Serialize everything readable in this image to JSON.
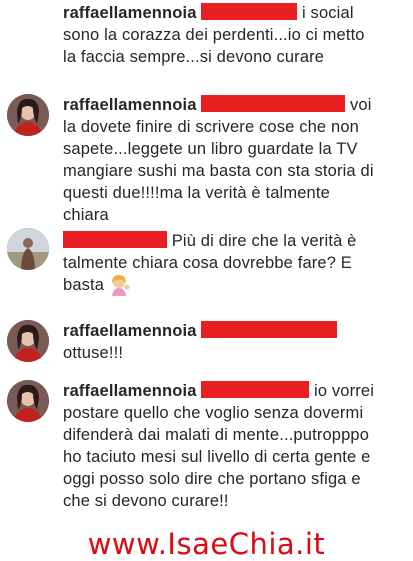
{
  "comments": [
    {
      "avatar": "avatar-photo",
      "username": "raffaellamennoia",
      "text_after_redaction": "i social sono la corazza dei perdenti...io ci metto la faccia sempre...si devono curare"
    },
    {
      "avatar": "avatar-photo",
      "username": "raffaellamennoia",
      "text_after_redaction": "voi la dovete finire di scrivere cose che non sapete...leggete un libro guardate la TV mangiare sushi ma basta con sta storia di questi due!!!!ma la verità è talmente chiara"
    },
    {
      "avatar": "avatar-photo",
      "username": "",
      "text_after_redaction": "Più di dire che la verità è talmente chiara cosa dovrebbe fare? E basta",
      "emoji": "woman-tipping-hand-emoji"
    },
    {
      "avatar": "avatar-photo",
      "username": "raffaellamennoia",
      "text_after_redaction": "ottuse!!!"
    },
    {
      "avatar": "avatar-photo",
      "username": "raffaellamennoia",
      "text_after_redaction": "io vorrei postare quello che voglio senza dovermi difenderà dai malati di mente...putropppo ho taciuto mesi sul livello di certa gente e oggi posso solo dire che portano sfiga e che si devono curare!!"
    }
  ],
  "watermark": "www.IsaeChia.it",
  "colors": {
    "redaction": "#ea1f22",
    "watermark": "#d90c14",
    "text": "#262626"
  }
}
